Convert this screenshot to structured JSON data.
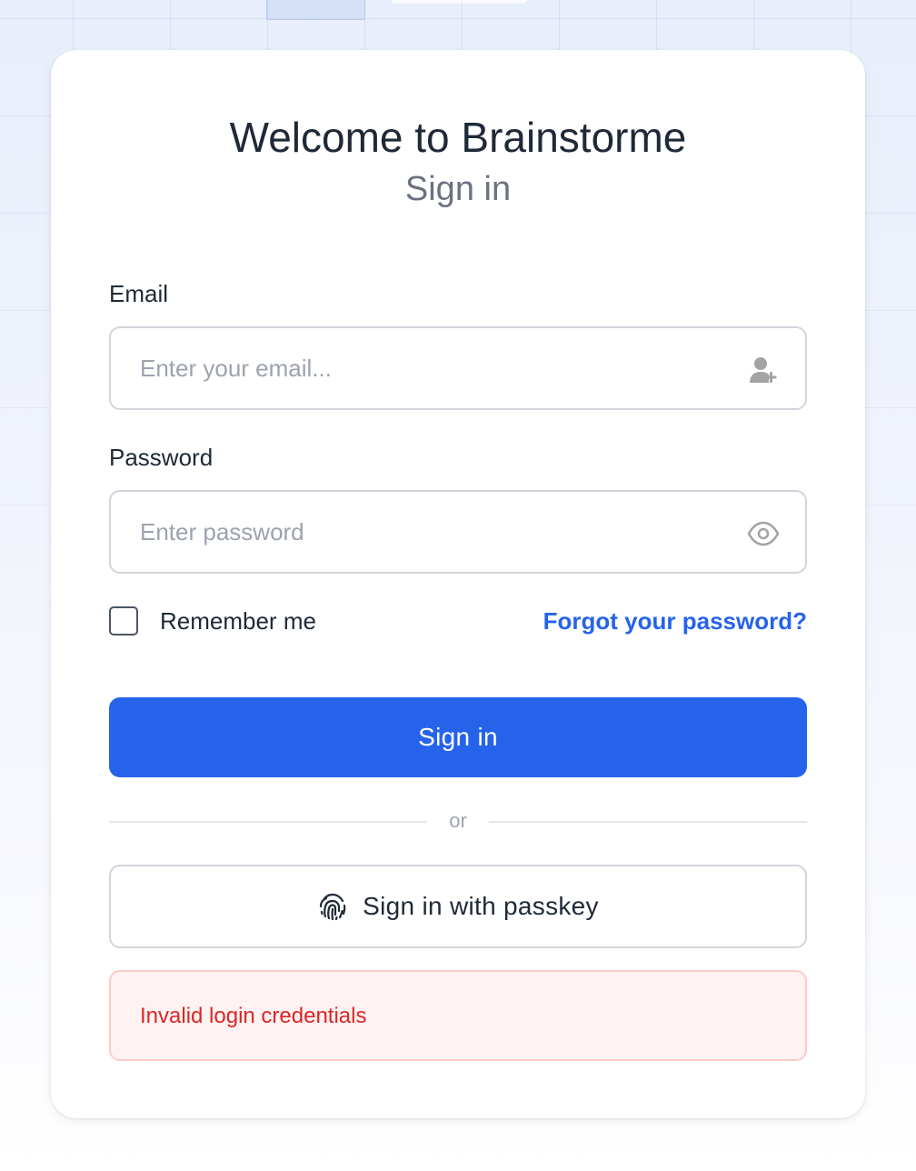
{
  "app": {
    "title": "Welcome to Brainstorme",
    "subtitle": "Sign in"
  },
  "form": {
    "email": {
      "label": "Email",
      "placeholder": "Enter your email...",
      "value": "",
      "icon": "user-plus-icon"
    },
    "password": {
      "label": "Password",
      "placeholder": "Enter password",
      "value": "",
      "icon": "eye-icon"
    },
    "remember_label": "Remember me",
    "remember_checked": false,
    "forgot_label": "Forgot your password?",
    "submit_label": "Sign in",
    "divider_label": "or",
    "passkey_label": "Sign in with passkey",
    "passkey_icon": "fingerprint-icon"
  },
  "error": {
    "message": "Invalid login credentials"
  },
  "colors": {
    "accent": "#2563eb",
    "error_text": "#dc2626",
    "error_bg": "#fef2f2",
    "error_border": "#fecaca"
  }
}
